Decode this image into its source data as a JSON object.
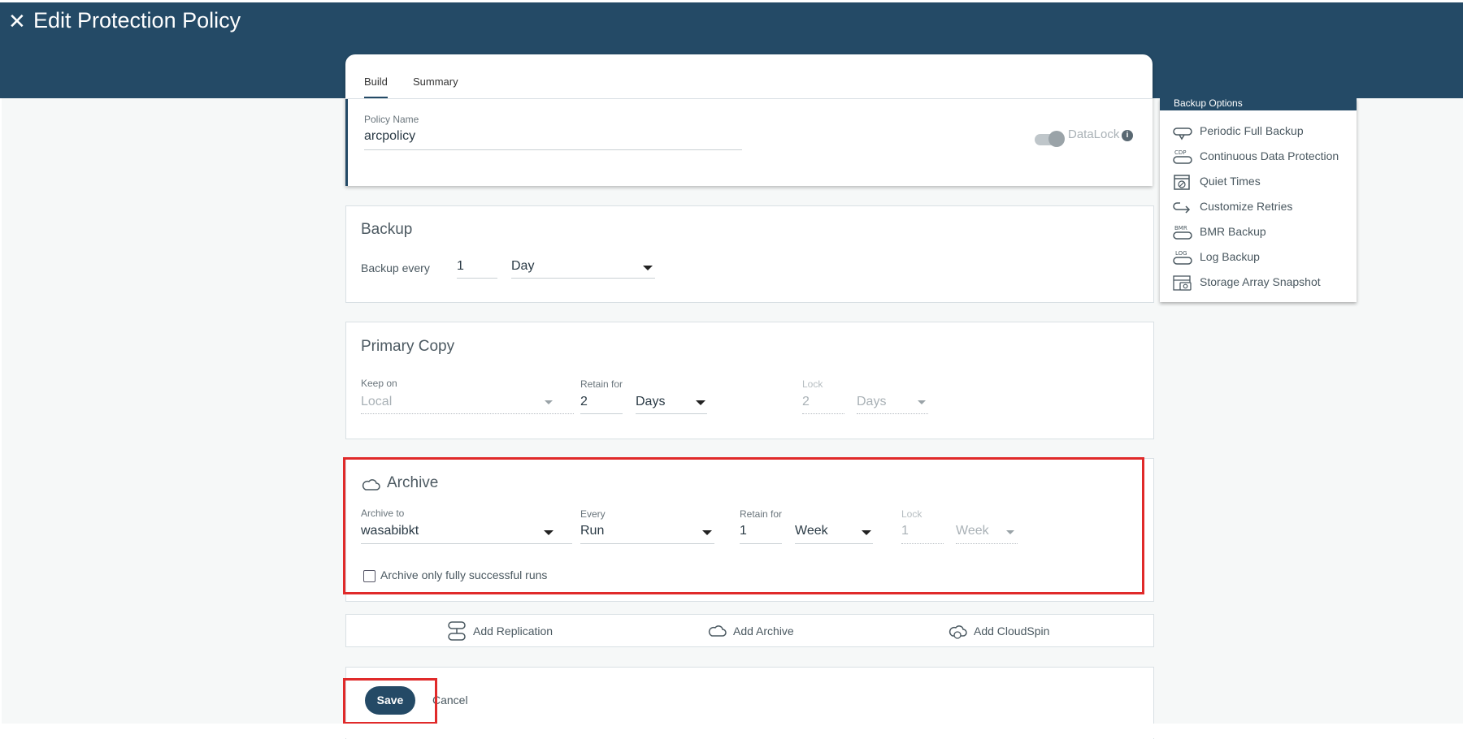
{
  "header": {
    "title": "Edit Protection Policy",
    "close_icon": "close-icon"
  },
  "tabs": [
    {
      "label": "Build",
      "active": true
    },
    {
      "label": "Summary",
      "active": false
    }
  ],
  "policy": {
    "name_label": "Policy Name",
    "name_value": "arcpolicy",
    "datalock_label": "DataLock",
    "datalock_on": false
  },
  "backup": {
    "title": "Backup",
    "every_label": "Backup every",
    "every_value": "1",
    "unit_value": "Day"
  },
  "primary_copy": {
    "title": "Primary Copy",
    "keep_on_label": "Keep on",
    "keep_on_value": "Local",
    "retain_label": "Retain for",
    "retain_value": "2",
    "retain_unit": "Days",
    "lock_label": "Lock",
    "lock_value": "2",
    "lock_unit": "Days"
  },
  "archive": {
    "title": "Archive",
    "archive_to_label": "Archive to",
    "archive_to_value": "wasabibkt",
    "every_label": "Every",
    "every_value": "Run",
    "retain_label": "Retain for",
    "retain_value": "1",
    "retain_unit": "Week",
    "lock_label": "Lock",
    "lock_value": "1",
    "lock_unit": "Week",
    "checkbox_label": "Archive only fully successful runs",
    "checkbox_checked": false
  },
  "add_buttons": [
    {
      "label": "Add Replication",
      "icon": "replication-icon"
    },
    {
      "label": "Add Archive",
      "icon": "cloud-icon"
    },
    {
      "label": "Add CloudSpin",
      "icon": "cloudspin-icon"
    }
  ],
  "actions": {
    "save_label": "Save",
    "cancel_label": "Cancel"
  },
  "backup_options": {
    "title": "Backup Options",
    "items": [
      {
        "label": "Periodic Full Backup",
        "icon": "periodic-full-backup-icon"
      },
      {
        "label": "Continuous Data Protection",
        "icon": "cdp-icon"
      },
      {
        "label": "Quiet Times",
        "icon": "calendar-icon"
      },
      {
        "label": "Customize Retries",
        "icon": "retry-icon"
      },
      {
        "label": "BMR Backup",
        "icon": "bmr-icon"
      },
      {
        "label": "Log Backup",
        "icon": "log-icon"
      },
      {
        "label": "Storage Array Snapshot",
        "icon": "snapshot-icon"
      }
    ]
  },
  "colors": {
    "header_bg": "#244a66",
    "highlight": "#e02a2a",
    "page_bg": "#f6f8f8"
  }
}
